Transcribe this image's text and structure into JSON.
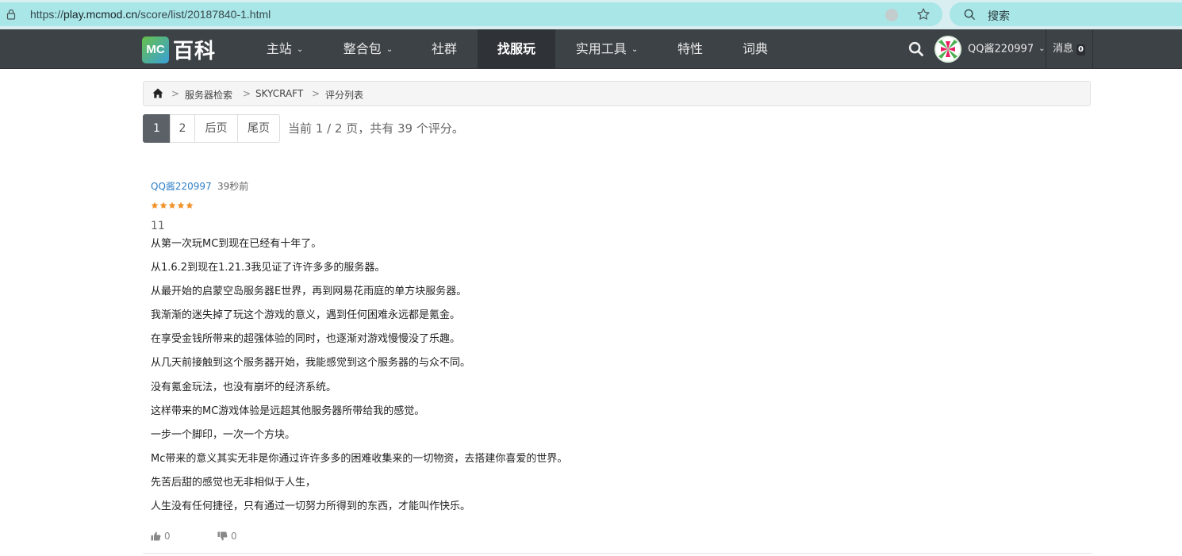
{
  "browser": {
    "url_prefix": "https://",
    "url_host": "play.mcmod.cn",
    "url_path": "/score/list/20187840-1.html",
    "search_placeholder": "搜索"
  },
  "nav": {
    "logo_badge": "MC",
    "logo_text": "百科",
    "items": [
      {
        "label": "主站",
        "dropdown": true
      },
      {
        "label": "整合包",
        "dropdown": true
      },
      {
        "label": "社群",
        "dropdown": false
      },
      {
        "label": "找服玩",
        "dropdown": false,
        "active": true
      },
      {
        "label": "实用工具",
        "dropdown": true
      },
      {
        "label": "特性",
        "dropdown": false
      },
      {
        "label": "词典",
        "dropdown": false
      }
    ],
    "user_name": "QQ酱220997",
    "messages_label": "消息",
    "messages_count": "0"
  },
  "breadcrumb": {
    "items": [
      "服务器检索",
      "SKYCRAFT",
      "评分列表"
    ],
    "separator": ">"
  },
  "pagination": {
    "pages": [
      "1",
      "2",
      "后页",
      "尾页"
    ],
    "current": "1",
    "info": "当前 1 / 2 页，共有 39 个评分。"
  },
  "comment": {
    "user": "QQ酱220997",
    "time": "39秒前",
    "rating": 5,
    "score": "11",
    "lines": [
      "从第一次玩MC到现在已经有十年了。",
      "从1.6.2到现在1.21.3我见证了许许多多的服务器。",
      "从最开始的启蒙空岛服务器E世界，再到网易花雨庭的单方块服务器。",
      "我渐渐的迷失掉了玩这个游戏的意义，遇到任何困难永远都是氪金。",
      "在享受金钱所带来的超强体验的同时，也逐渐对游戏慢慢没了乐趣。",
      "从几天前接触到这个服务器开始，我能感觉到这个服务器的与众不同。",
      "没有氪金玩法，也没有崩坏的经济系统。",
      "这样带来的MC游戏体验是远超其他服务器所带给我的感觉。",
      "一步一个脚印，一次一个方块。",
      "Mc带来的意义其实无非是你通过许许多多的困难收集来的一切物资，去搭建你喜爱的世界。",
      "先苦后甜的感觉也无非相似于人生，",
      "人生没有任何捷径，只有通过一切努力所得到的东西，才能叫作快乐。"
    ],
    "likes": "0",
    "dislikes": "0"
  },
  "colors": {
    "nav_bg": "#3d4247",
    "browser_bar": "#a8e6e8",
    "link_blue": "#2e7fc7",
    "star_orange": "#f0932b"
  }
}
